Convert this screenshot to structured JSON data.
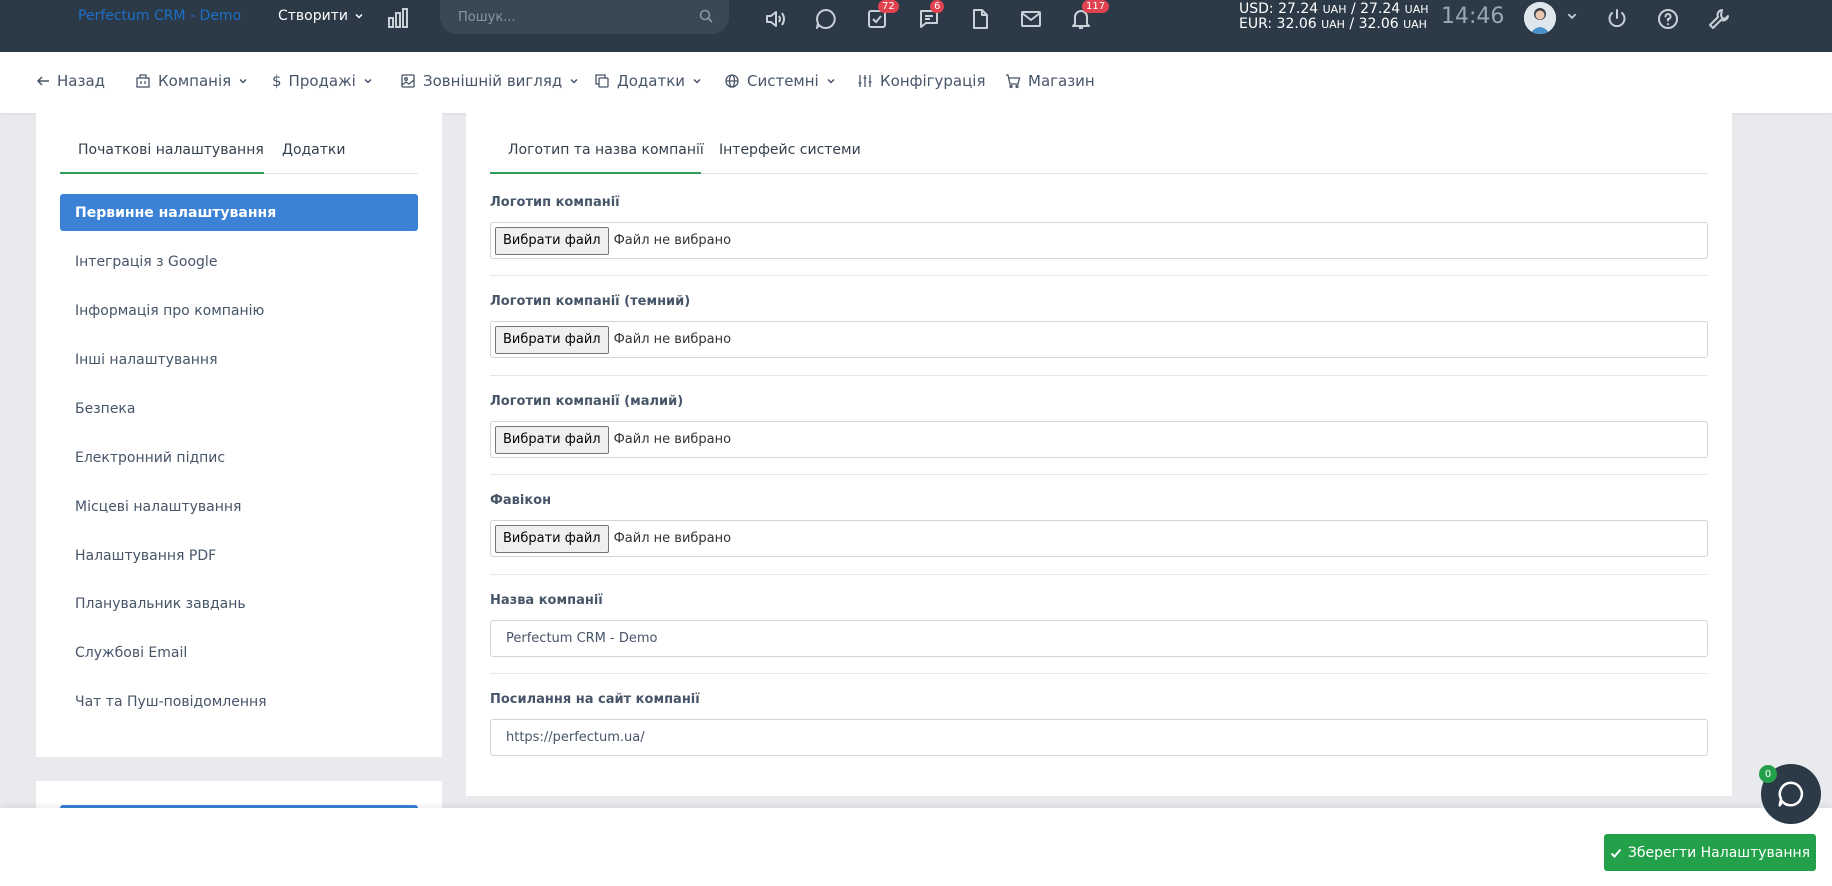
{
  "topbar": {
    "brand": "Perfectum CRM - Demo",
    "create_label": "Створити",
    "search_placeholder": "Пошук...",
    "badges": {
      "tasks": "72",
      "discussions": "6",
      "notifications": "117"
    },
    "rates": {
      "usd_prefix": "USD: 27.24",
      "usd_mid": "/ 27.24",
      "eur_prefix": "EUR: 32.06",
      "eur_mid": "/ 32.06",
      "currency": "UAH"
    },
    "clock": "14:46"
  },
  "nav": {
    "back": "Назад",
    "company": "Компанія",
    "sales": "Продажі",
    "appearance": "Зовнішній вигляд",
    "addons": "Додатки",
    "system": "Системні",
    "configuration": "Конфігурація",
    "store": "Магазин"
  },
  "left_tabs": {
    "initial": "Початкові налаштування",
    "addons": "Додатки"
  },
  "left_menu": [
    "Первинне налаштування",
    "Інтеграція з Google",
    "Інформація про компанію",
    "Інші налаштування",
    "Безпека",
    "Електронний підпис",
    "Місцеві налаштування",
    "Налаштування PDF",
    "Планувальник завдань",
    "Службові Email",
    "Чат та Пуш-повідомлення"
  ],
  "right_tabs": {
    "logo": "Логотип та назва компанії",
    "interface": "Інтерфейс системи"
  },
  "form": {
    "file_button": "Вибрати файл",
    "no_file": "Файл не вибрано",
    "logo_label": "Логотип компанії",
    "logo_dark_label": "Логотип компанії (темний)",
    "logo_small_label": "Логотип компанії (малий)",
    "favicon_label": "Фавікон",
    "company_name_label": "Назва компанії",
    "company_name_value": "Perfectum CRM - Demo",
    "company_site_label": "Посилання на сайт компанії",
    "company_site_value": "https://perfectum.ua/"
  },
  "footer": {
    "save_label": "Зберегти Налаштування",
    "chat_badge": "0"
  },
  "colors": {
    "topbar": "#2c3a47",
    "accent_blue": "#3b82d6",
    "accent_green": "#22a14a",
    "badge_red": "#e0434f"
  }
}
